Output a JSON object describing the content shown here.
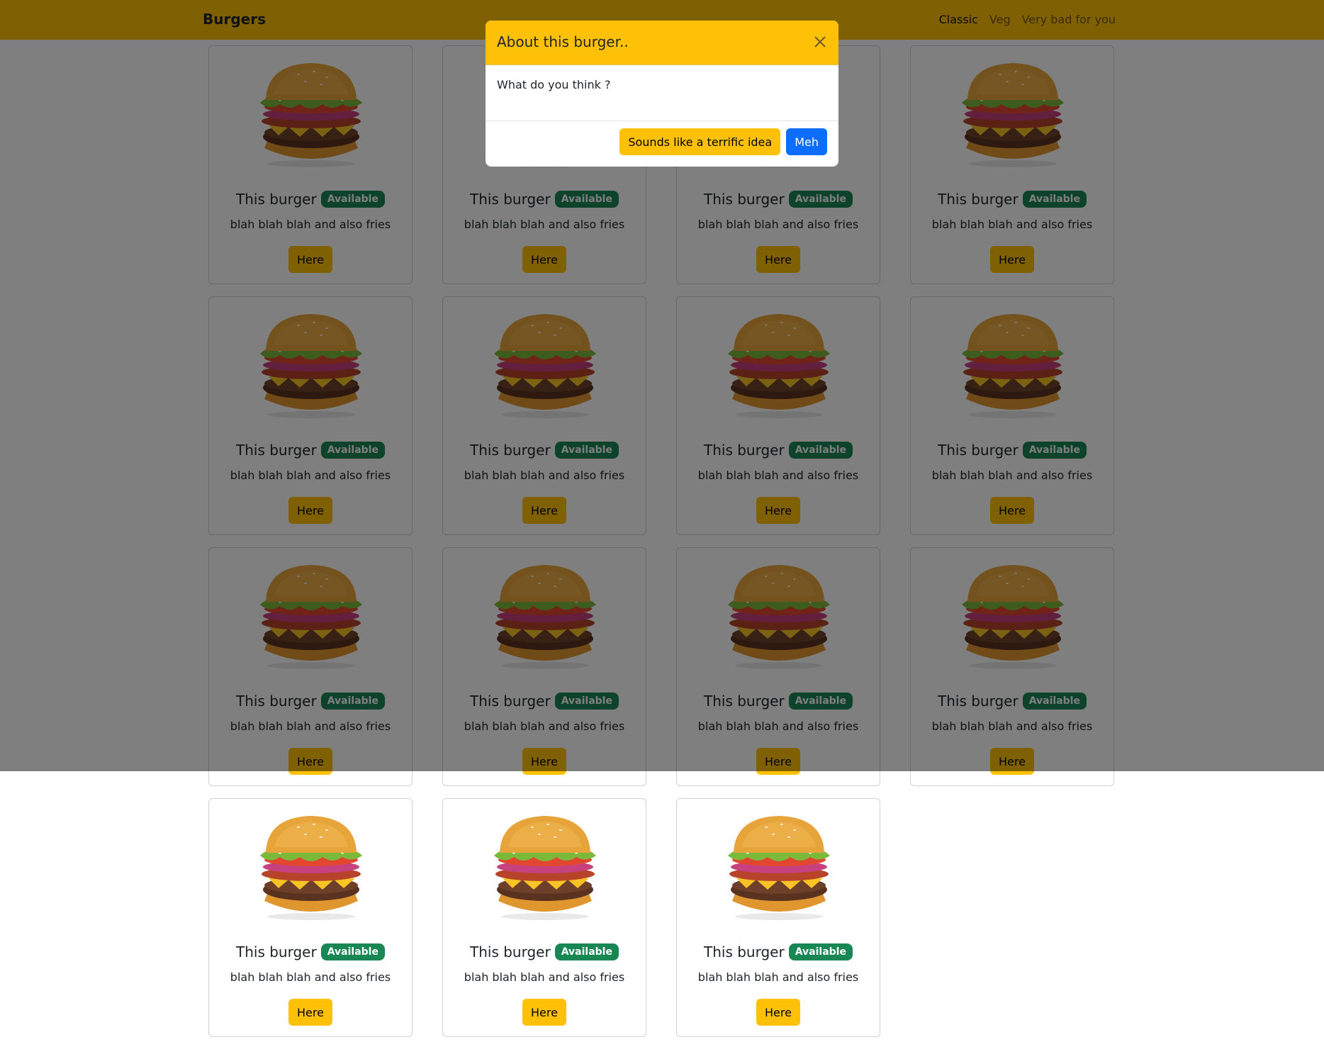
{
  "navbar": {
    "brand": "Burgers",
    "links": [
      {
        "label": "Classic",
        "active": true
      },
      {
        "label": "Veg",
        "active": false
      },
      {
        "label": "Very bad for you",
        "active": false
      }
    ]
  },
  "cards": [
    {
      "title": "This burger",
      "badge": "Available",
      "text": "blah blah blah and also fries",
      "button": "Here"
    },
    {
      "title": "This burger",
      "badge": "Available",
      "text": "blah blah blah and also fries",
      "button": "Here"
    },
    {
      "title": "This burger",
      "badge": "Available",
      "text": "blah blah blah and also fries",
      "button": "Here"
    },
    {
      "title": "This burger",
      "badge": "Available",
      "text": "blah blah blah and also fries",
      "button": "Here"
    },
    {
      "title": "This burger",
      "badge": "Available",
      "text": "blah blah blah and also fries",
      "button": "Here"
    },
    {
      "title": "This burger",
      "badge": "Available",
      "text": "blah blah blah and also fries",
      "button": "Here"
    },
    {
      "title": "This burger",
      "badge": "Available",
      "text": "blah blah blah and also fries",
      "button": "Here"
    },
    {
      "title": "This burger",
      "badge": "Available",
      "text": "blah blah blah and also fries",
      "button": "Here"
    },
    {
      "title": "This burger",
      "badge": "Available",
      "text": "blah blah blah and also fries",
      "button": "Here"
    },
    {
      "title": "This burger",
      "badge": "Available",
      "text": "blah blah blah and also fries",
      "button": "Here"
    },
    {
      "title": "This burger",
      "badge": "Available",
      "text": "blah blah blah and also fries",
      "button": "Here"
    },
    {
      "title": "This burger",
      "badge": "Available",
      "text": "blah blah blah and also fries",
      "button": "Here"
    },
    {
      "title": "This burger",
      "badge": "Available",
      "text": "blah blah blah and also fries",
      "button": "Here"
    },
    {
      "title": "This burger",
      "badge": "Available",
      "text": "blah blah blah and also fries",
      "button": "Here"
    },
    {
      "title": "This burger",
      "badge": "Available",
      "text": "blah blah blah and also fries",
      "button": "Here"
    }
  ],
  "modal": {
    "title": "About this burger..",
    "body": "What do you think ?",
    "confirm_label": "Sounds like a terrific idea",
    "dismiss_label": "Meh",
    "close_icon": "close-icon"
  },
  "colors": {
    "accent": "#ffc107",
    "badge": "#198754",
    "primary": "#0d6efd"
  }
}
